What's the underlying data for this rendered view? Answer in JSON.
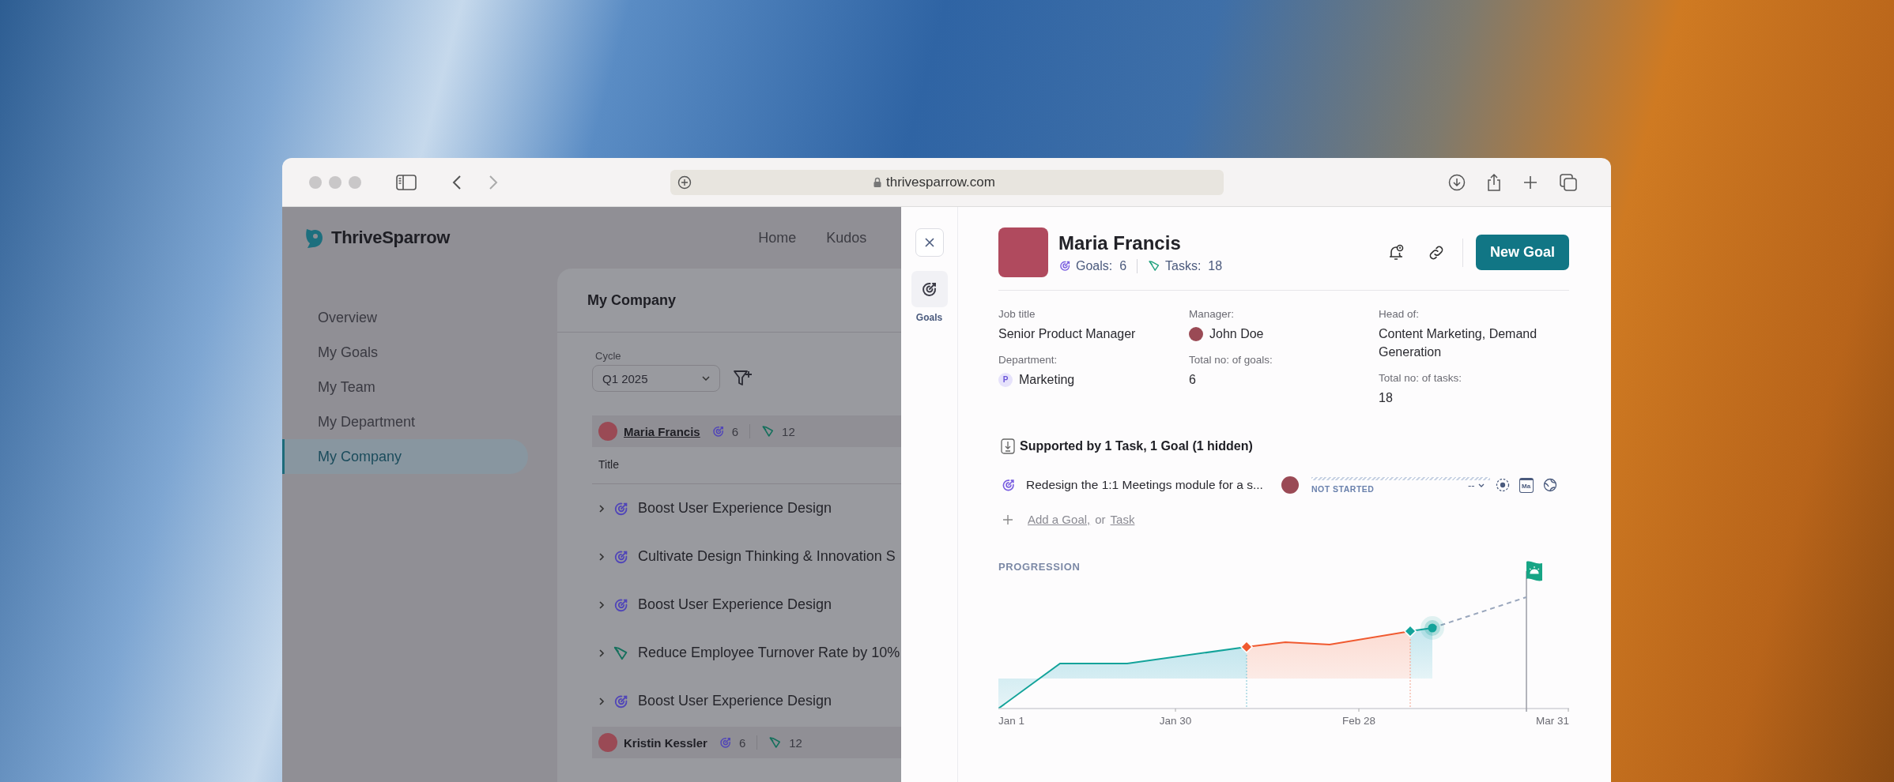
{
  "browser": {
    "url": "thrivesparrow.com"
  },
  "app": {
    "brand": "ThriveSparrow",
    "nav": [
      {
        "label": "Home"
      },
      {
        "label": "Kudos"
      }
    ],
    "sidebar": [
      {
        "label": "Overview",
        "selected": false
      },
      {
        "label": "My Goals",
        "selected": false
      },
      {
        "label": "My Team",
        "selected": false
      },
      {
        "label": "My Department",
        "selected": false
      },
      {
        "label": "My Company",
        "selected": true
      }
    ],
    "page_title": "My Company",
    "cycle": {
      "label": "Cycle",
      "value": "Q1 2025"
    },
    "groups": [
      {
        "name": "Maria Francis",
        "kind": "link",
        "goals": "6",
        "tasks": "12",
        "column_header": "Title",
        "rows": [
          {
            "title": "Boost User Experience Design",
            "kind": "goal"
          },
          {
            "title": "Cultivate Design Thinking & Innovation S",
            "kind": "goal"
          },
          {
            "title": "Boost User Experience Design",
            "kind": "goal"
          },
          {
            "title": "Reduce Employee Turnover Rate by 10%",
            "kind": "task"
          },
          {
            "title": "Boost User Experience Design",
            "kind": "goal"
          }
        ]
      },
      {
        "name": "Kristin Kessler",
        "kind": "text",
        "goals": "6",
        "tasks": "12"
      }
    ]
  },
  "drawer": {
    "rail": [
      {
        "label": "Goals",
        "selected": true
      }
    ],
    "profile": {
      "name": "Maria Francis",
      "goals_label": "Goals:",
      "goals": "6",
      "tasks_label": "Tasks:",
      "tasks": "18"
    },
    "primary_button": "New Goal",
    "details": [
      {
        "fields": [
          {
            "label": "Job title",
            "value": "Senior Product Manager",
            "kind": "text"
          },
          {
            "label": "Department:",
            "value": "Marketing",
            "kind": "department",
            "badge": "P"
          }
        ]
      },
      {
        "fields": [
          {
            "label": "Manager:",
            "value": "John Doe",
            "kind": "person"
          },
          {
            "label": "Total no: of goals:",
            "value": "6",
            "kind": "text"
          }
        ]
      },
      {
        "fields": [
          {
            "label": "Head of:",
            "value": "Content Marketing, Demand Generation",
            "kind": "text"
          },
          {
            "label": "Total no: of tasks:",
            "value": "18",
            "kind": "text"
          }
        ]
      }
    ],
    "supported": {
      "heading": "Supported by 1 Task, 1 Goal (1 hidden)",
      "items": [
        {
          "title": "Redesign the 1:1 Meetings module for a s...",
          "kind": "goal",
          "status": "NOT STARTED",
          "value": "--",
          "calendar_label": "Ma"
        }
      ],
      "add": {
        "goal_link": "Add a Goal,",
        "joiner": "or",
        "task_link": "Task"
      }
    },
    "progression": {
      "title": "PROGRESSION",
      "axis_labels": [
        "Jan 1",
        "Jan 30",
        "Feb 28",
        "Mar 31"
      ]
    }
  }
}
